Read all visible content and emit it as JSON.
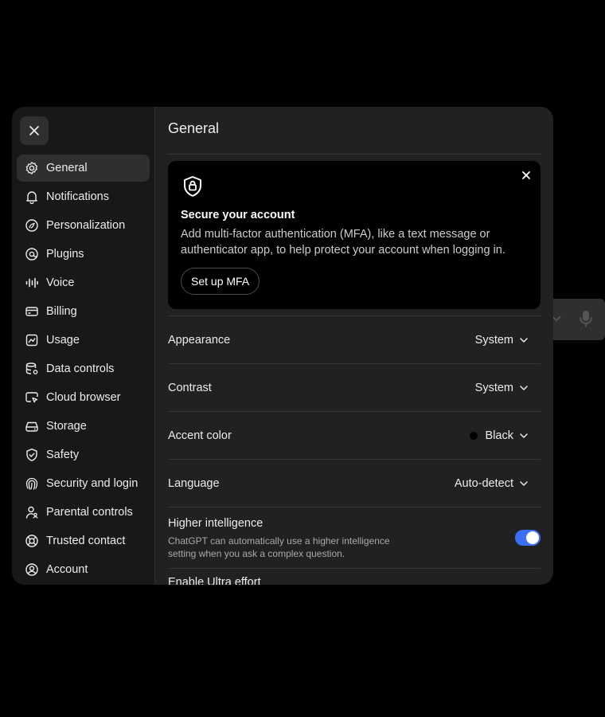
{
  "background": {
    "app_icons": [
      "chevron-down-icon",
      "microphone-icon"
    ]
  },
  "dialog": {
    "close_icon": "close-icon",
    "sidebar": {
      "items": [
        {
          "label": "General",
          "icon": "gear-icon",
          "active": true
        },
        {
          "label": "Notifications",
          "icon": "bell-icon"
        },
        {
          "label": "Personalization",
          "icon": "personalization-icon"
        },
        {
          "label": "Plugins",
          "icon": "plugins-icon"
        },
        {
          "label": "Voice",
          "icon": "voice-waveform-icon"
        },
        {
          "label": "Billing",
          "icon": "credit-card-icon"
        },
        {
          "label": "Usage",
          "icon": "usage-chart-icon"
        },
        {
          "label": "Data controls",
          "icon": "database-icon"
        },
        {
          "label": "Cloud browser",
          "icon": "cloud-browser-icon"
        },
        {
          "label": "Storage",
          "icon": "storage-icon"
        },
        {
          "label": "Safety",
          "icon": "shield-check-icon"
        },
        {
          "label": "Security and login",
          "icon": "fingerprint-icon"
        },
        {
          "label": "Parental controls",
          "icon": "parental-icon"
        },
        {
          "label": "Trusted contact",
          "icon": "lifebuoy-icon"
        },
        {
          "label": "Account",
          "icon": "user-circle-icon"
        }
      ]
    },
    "main": {
      "title": "General",
      "mfa_card": {
        "icon": "shield-lock-icon",
        "title": "Secure your account",
        "description": "Add multi-factor authentication (MFA), like a text message or authenticator app, to help protect your account when logging in.",
        "button_label": "Set up MFA"
      },
      "settings": {
        "appearance": {
          "label": "Appearance",
          "value": "System"
        },
        "contrast": {
          "label": "Contrast",
          "value": "System"
        },
        "accent_color": {
          "label": "Accent color",
          "value": "Black",
          "swatch": "#000000"
        },
        "language": {
          "label": "Language",
          "value": "Auto-detect"
        },
        "higher_intelligence": {
          "label": "Higher intelligence",
          "description": "ChatGPT can automatically use a higher intelligence setting when you ask a complex question.",
          "enabled": true
        },
        "ultra_effort": {
          "label": "Enable Ultra effort"
        }
      }
    }
  },
  "colors": {
    "accent": "#3b6ff5",
    "panel": "#212121",
    "sidebar": "#181818"
  }
}
